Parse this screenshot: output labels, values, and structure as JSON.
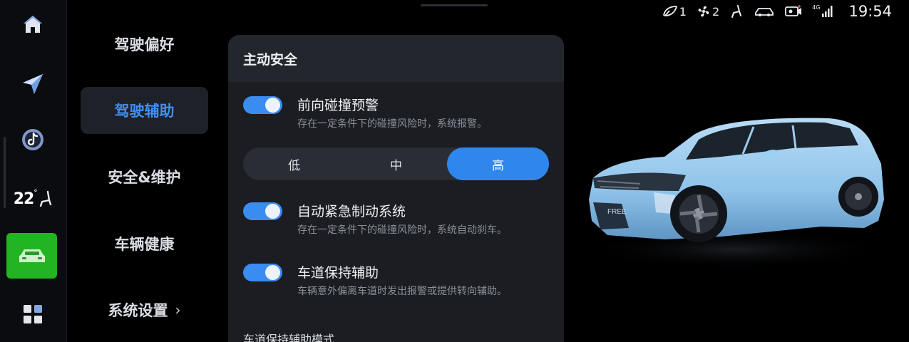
{
  "status_bar": {
    "seat_heat_level": "1",
    "fan_level": "2",
    "signal_label": "4G",
    "time": "19:54"
  },
  "rail": {
    "temperature": "22",
    "temperature_unit": "°",
    "items": [
      "home-icon",
      "navigation-icon",
      "music-icon",
      "climate-seat-icon",
      "car-icon",
      "apps-grid-icon"
    ],
    "active_color": "#22b422"
  },
  "menu": {
    "items": [
      {
        "label": "驾驶偏好"
      },
      {
        "label": "驾驶辅助"
      },
      {
        "label": "安全&维护"
      },
      {
        "label": "车辆健康"
      },
      {
        "label": "系统设置"
      }
    ],
    "active_index": 1,
    "accent": "#3f8ff5"
  },
  "panel": {
    "title": "主动安全",
    "options": [
      {
        "title": "前向碰撞预警",
        "desc": "存在一定条件下的碰撞风险时，系统报警。",
        "enabled": true
      },
      {
        "title": "自动紧急制动系统",
        "desc": "存在一定条件下的碰撞风险时，系统自动刹车。",
        "enabled": true
      },
      {
        "title": "车道保持辅助",
        "desc": "车辆意外偏离车道时发出报警或提供转向辅助。",
        "enabled": true
      }
    ],
    "sensitivity": {
      "options": [
        "低",
        "中",
        "高"
      ],
      "selected": "高"
    },
    "next_section": "车道保持辅助模式"
  },
  "car_badge": "FREE"
}
